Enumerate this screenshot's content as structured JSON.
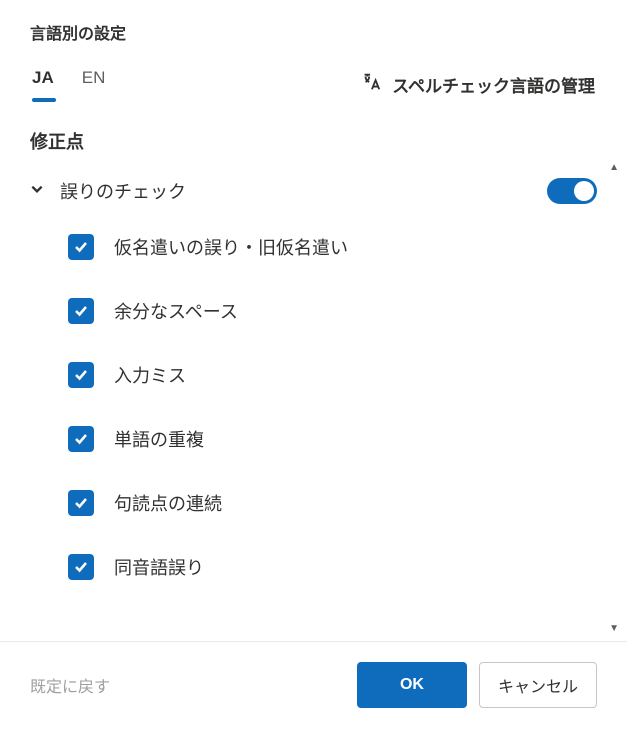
{
  "title": "言語別の設定",
  "tabs": {
    "ja": "JA",
    "en": "EN"
  },
  "spellcheck_link": "スペルチェック言語の管理",
  "section_title": "修正点",
  "group": {
    "label": "誤りのチェック",
    "items": [
      "仮名遣いの誤り・旧仮名遣い",
      "余分なスペース",
      "入力ミス",
      "単語の重複",
      "句読点の連続",
      "同音語誤り"
    ]
  },
  "footer": {
    "reset": "既定に戻す",
    "ok": "OK",
    "cancel": "キャンセル"
  }
}
